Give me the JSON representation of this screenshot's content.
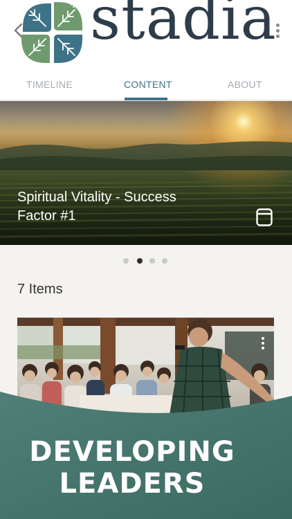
{
  "header": {
    "logo_text": "stadia",
    "back_icon": "chevron-left-icon",
    "menu_icon": "kebab-menu-icon"
  },
  "tabs": [
    {
      "label": "TIMELINE",
      "active": false
    },
    {
      "label": "CONTENT",
      "active": true
    },
    {
      "label": "ABOUT",
      "active": false
    }
  ],
  "hero": {
    "title": "Spiritual Vitality - Success Factor #1",
    "type_icon": "book-icon"
  },
  "carousel": {
    "pages": 4,
    "current": 2
  },
  "content": {
    "count_label": "7 Items"
  },
  "card": {
    "menu_icon": "kebab-menu-icon"
  },
  "banner": {
    "line1": "DEVELOPING",
    "line2": "LEADERS"
  },
  "colors": {
    "accent": "#3e7387",
    "banner_start": "#4f7f76",
    "banner_end": "#3b6a62",
    "logo_text": "#2f3c4a"
  }
}
